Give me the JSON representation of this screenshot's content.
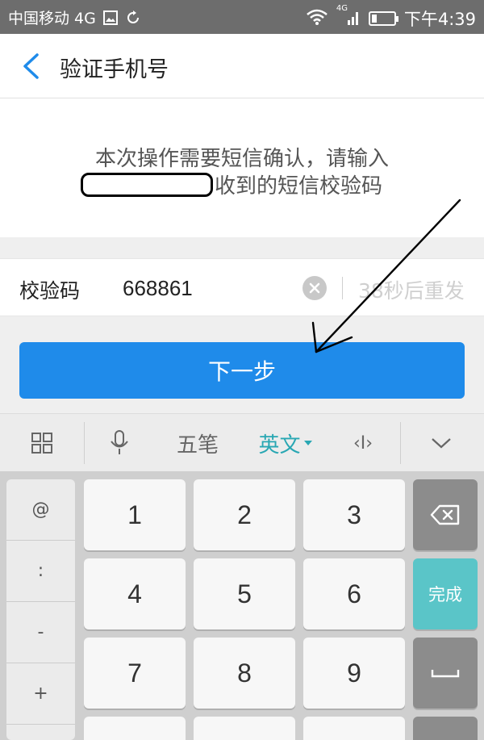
{
  "status_bar": {
    "carrier": "中国移动 4G",
    "network_tag": "4G",
    "time": "下午4:39",
    "icons": [
      "image-icon",
      "sync-icon",
      "wifi-icon",
      "signal-icon",
      "battery-icon"
    ],
    "battery_level": 0.25
  },
  "header": {
    "title": "验证手机号",
    "back_icon": "chevron-left-icon"
  },
  "info": {
    "line1": "本次操作需要短信确认，请输入",
    "line2_suffix": "收到的短信校验码"
  },
  "code_field": {
    "label": "校验码",
    "value": "668861",
    "clear_icon": "clear-circle-icon",
    "resend_text": "38秒后重发"
  },
  "next_button": {
    "label": "下一步"
  },
  "keyboard_toolbar": {
    "grid_icon": "grid-icon",
    "mic_icon": "microphone-icon",
    "wubi_label": "五笔",
    "english_label": "英文",
    "cursor_label": "‹I›",
    "collapse_icon": "chevron-down-icon"
  },
  "keyboard": {
    "symbols": [
      "@",
      ":",
      "-",
      "+"
    ],
    "digits": [
      "1",
      "2",
      "3",
      "4",
      "5",
      "6",
      "7",
      "8",
      "9"
    ],
    "done_label": "完成",
    "backspace_icon": "backspace-icon",
    "space_icon": "space-icon"
  },
  "colors": {
    "status_bar": "#6d6d6d",
    "primary_button": "#1f8bea",
    "accent_teal": "#5ac5c8",
    "back_arrow": "#1f8bea"
  }
}
